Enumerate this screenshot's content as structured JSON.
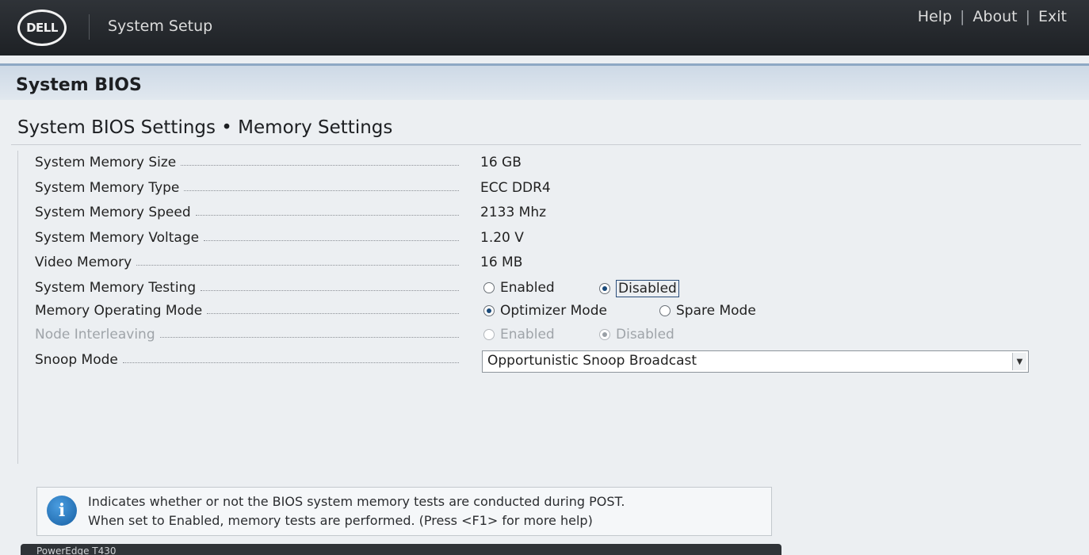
{
  "header": {
    "logo_text": "DELL",
    "app_title": "System Setup",
    "links": [
      "Help",
      "About",
      "Exit"
    ],
    "link_separator": "|"
  },
  "section": {
    "title": "System BIOS"
  },
  "page": {
    "title": "System BIOS Settings • Memory Settings"
  },
  "settings": {
    "memory_size": {
      "label": "System Memory Size",
      "value": "16 GB"
    },
    "memory_type": {
      "label": "System Memory Type",
      "value": "ECC DDR4"
    },
    "memory_speed": {
      "label": "System Memory Speed",
      "value": "2133 Mhz"
    },
    "memory_voltage": {
      "label": "System Memory Voltage",
      "value": "1.20 V"
    },
    "video_memory": {
      "label": "Video Memory",
      "value": "16 MB"
    },
    "memory_testing": {
      "label": "System Memory Testing",
      "options": [
        "Enabled",
        "Disabled"
      ],
      "selected": "Disabled"
    },
    "operating_mode": {
      "label": "Memory Operating Mode",
      "options": [
        "Optimizer Mode",
        "Spare Mode"
      ],
      "selected": "Optimizer Mode"
    },
    "node_interleaving": {
      "label": "Node Interleaving",
      "options": [
        "Enabled",
        "Disabled"
      ],
      "selected": "Disabled",
      "state": "disabled"
    },
    "snoop_mode": {
      "label": "Snoop Mode",
      "value": "Opportunistic Snoop Broadcast"
    }
  },
  "help": {
    "line1": "Indicates whether or not the BIOS system memory tests are conducted during POST.",
    "line2": "When set to Enabled, memory tests are performed. (Press <F1> for more help)"
  },
  "footer": {
    "model": "PowerEdge T430"
  },
  "colors": {
    "header_bg": "#1e2125",
    "section_bar": "#cdd9e6",
    "accent": "#1a4a7a"
  }
}
